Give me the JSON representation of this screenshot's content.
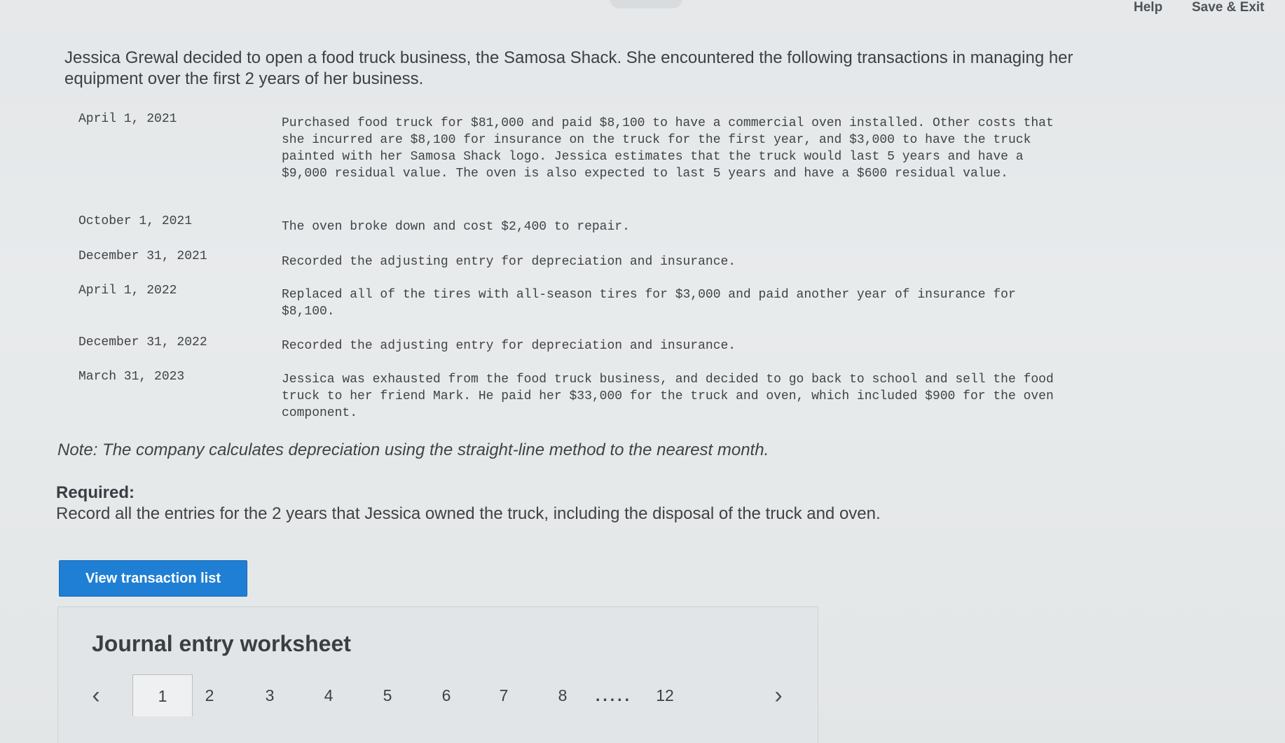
{
  "header": {
    "help_label": "Help",
    "save_exit_label": "Save & Exit"
  },
  "intro": "Jessica Grewal decided to open a food truck business, the Samosa Shack. She encountered the following transactions in managing her equipment over the first 2 years of her business.",
  "transactions": [
    {
      "date": "April 1, 2021",
      "description": "Purchased food truck for $81,000 and paid $8,100 to have a commercial oven installed. Other costs that she incurred are $8,100 for insurance on the truck for the first year, and $3,000 to have the truck painted with her Samosa Shack logo. Jessica estimates that the truck would last 5 years and have a $9,000 residual value. The oven is also expected to last 5 years and have a $600 residual value."
    },
    {
      "date": "October 1, 2021",
      "description": "The oven broke down and cost $2,400 to repair."
    },
    {
      "date": "December 31, 2021",
      "description": "Recorded the adjusting entry for depreciation and insurance."
    },
    {
      "date": "April 1, 2022",
      "description": "Replaced all of the tires with all-season tires for $3,000 and paid another year of insurance for $8,100."
    },
    {
      "date": "December 31, 2022",
      "description": "Recorded the adjusting entry for depreciation and insurance."
    },
    {
      "date": "March 31, 2023",
      "description": "Jessica was exhausted from the food truck business, and decided to go back to school and sell the food truck to her friend Mark. He paid her $33,000 for the truck and oven, which included $900 for the oven component."
    }
  ],
  "note": "Note: The company calculates depreciation using the straight-line method to the nearest month.",
  "required": {
    "title": "Required:",
    "text": "Record all the entries for the 2 years that Jessica owned the truck, including the disposal of the truck and oven."
  },
  "view_button_label": "View transaction list",
  "worksheet": {
    "title": "Journal entry worksheet",
    "pages": [
      "1",
      "2",
      "3",
      "4",
      "5",
      "6",
      "7",
      "8"
    ],
    "ellipsis": ".....",
    "last_page": "12",
    "active_page": "1",
    "prev_icon": "chevron-left-icon",
    "next_icon": "chevron-right-icon"
  }
}
